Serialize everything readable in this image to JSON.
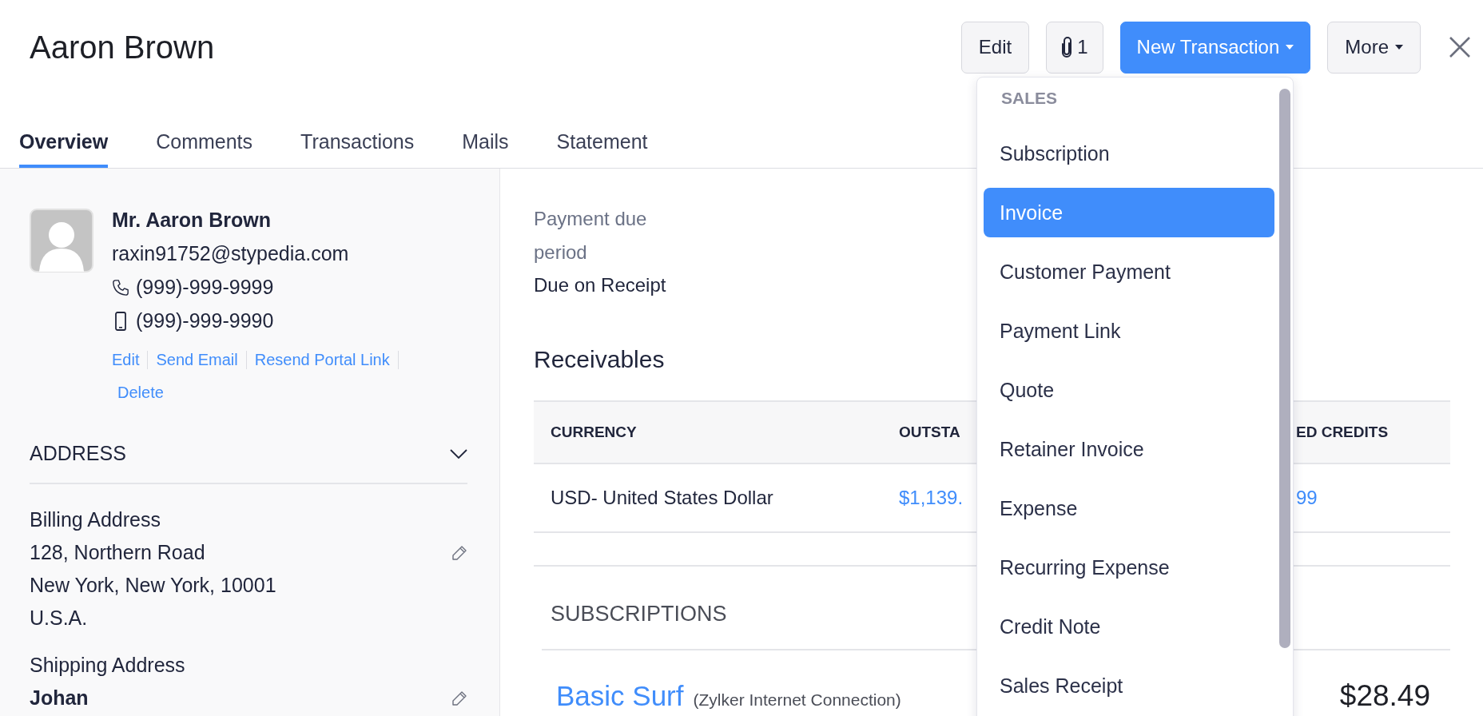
{
  "header": {
    "title": "Aaron Brown",
    "buttons": [
      {
        "kind": "plain",
        "label": "Edit",
        "caret": false
      },
      {
        "kind": "attachment",
        "label": "1",
        "caret": false
      },
      {
        "kind": "primary",
        "label": "New Transaction",
        "caret": true
      },
      {
        "kind": "plain",
        "label": "More",
        "caret": true
      }
    ]
  },
  "tabs": [
    {
      "label": "Overview",
      "selected": true
    },
    {
      "label": "Comments",
      "selected": false
    },
    {
      "label": "Transactions",
      "selected": false
    },
    {
      "label": "Mails",
      "selected": false
    },
    {
      "label": "Statement",
      "selected": false
    }
  ],
  "contact": {
    "name": "Mr. Aaron Brown",
    "email": "raxin91752@stypedia.com",
    "phone": "(999)-999-9999",
    "mobile": "(999)-999-9990",
    "links": [
      "Edit",
      "Send Email",
      "Resend Portal Link",
      "Delete"
    ]
  },
  "address": {
    "heading": "ADDRESS",
    "sections": [
      {
        "label": "Billing Address",
        "lines": [
          "128, Northern Road",
          "New York, New York, 10001",
          "U.S.A."
        ]
      },
      {
        "label": "Shipping Address",
        "lines": [
          "Johan"
        ]
      }
    ]
  },
  "payment_terms": {
    "label": "Payment due period",
    "value": "Due on Receipt"
  },
  "receivables": {
    "title": "Receivables",
    "columns": [
      "CURRENCY",
      "OUTSTA",
      "ED CREDITS"
    ],
    "rows": [
      [
        "USD- United States Dollar",
        "$1,139.",
        "99"
      ]
    ]
  },
  "subscriptions": {
    "heading": "SUBSCRIPTIONS",
    "items": [
      {
        "name": "Basic Surf",
        "product": "(Zylker Internet Connection)",
        "amount": "$28.49"
      }
    ]
  },
  "menu": {
    "section": "SALES",
    "items": [
      {
        "label": "Subscription",
        "selected": false
      },
      {
        "label": "Invoice",
        "selected": true
      },
      {
        "label": "Customer Payment",
        "selected": false
      },
      {
        "label": "Payment Link",
        "selected": false
      },
      {
        "label": "Quote",
        "selected": false
      },
      {
        "label": "Retainer Invoice",
        "selected": false
      },
      {
        "label": "Expense",
        "selected": false
      },
      {
        "label": "Recurring Expense",
        "selected": false
      },
      {
        "label": "Credit Note",
        "selected": false
      },
      {
        "label": "Sales Receipt",
        "selected": false
      }
    ]
  }
}
